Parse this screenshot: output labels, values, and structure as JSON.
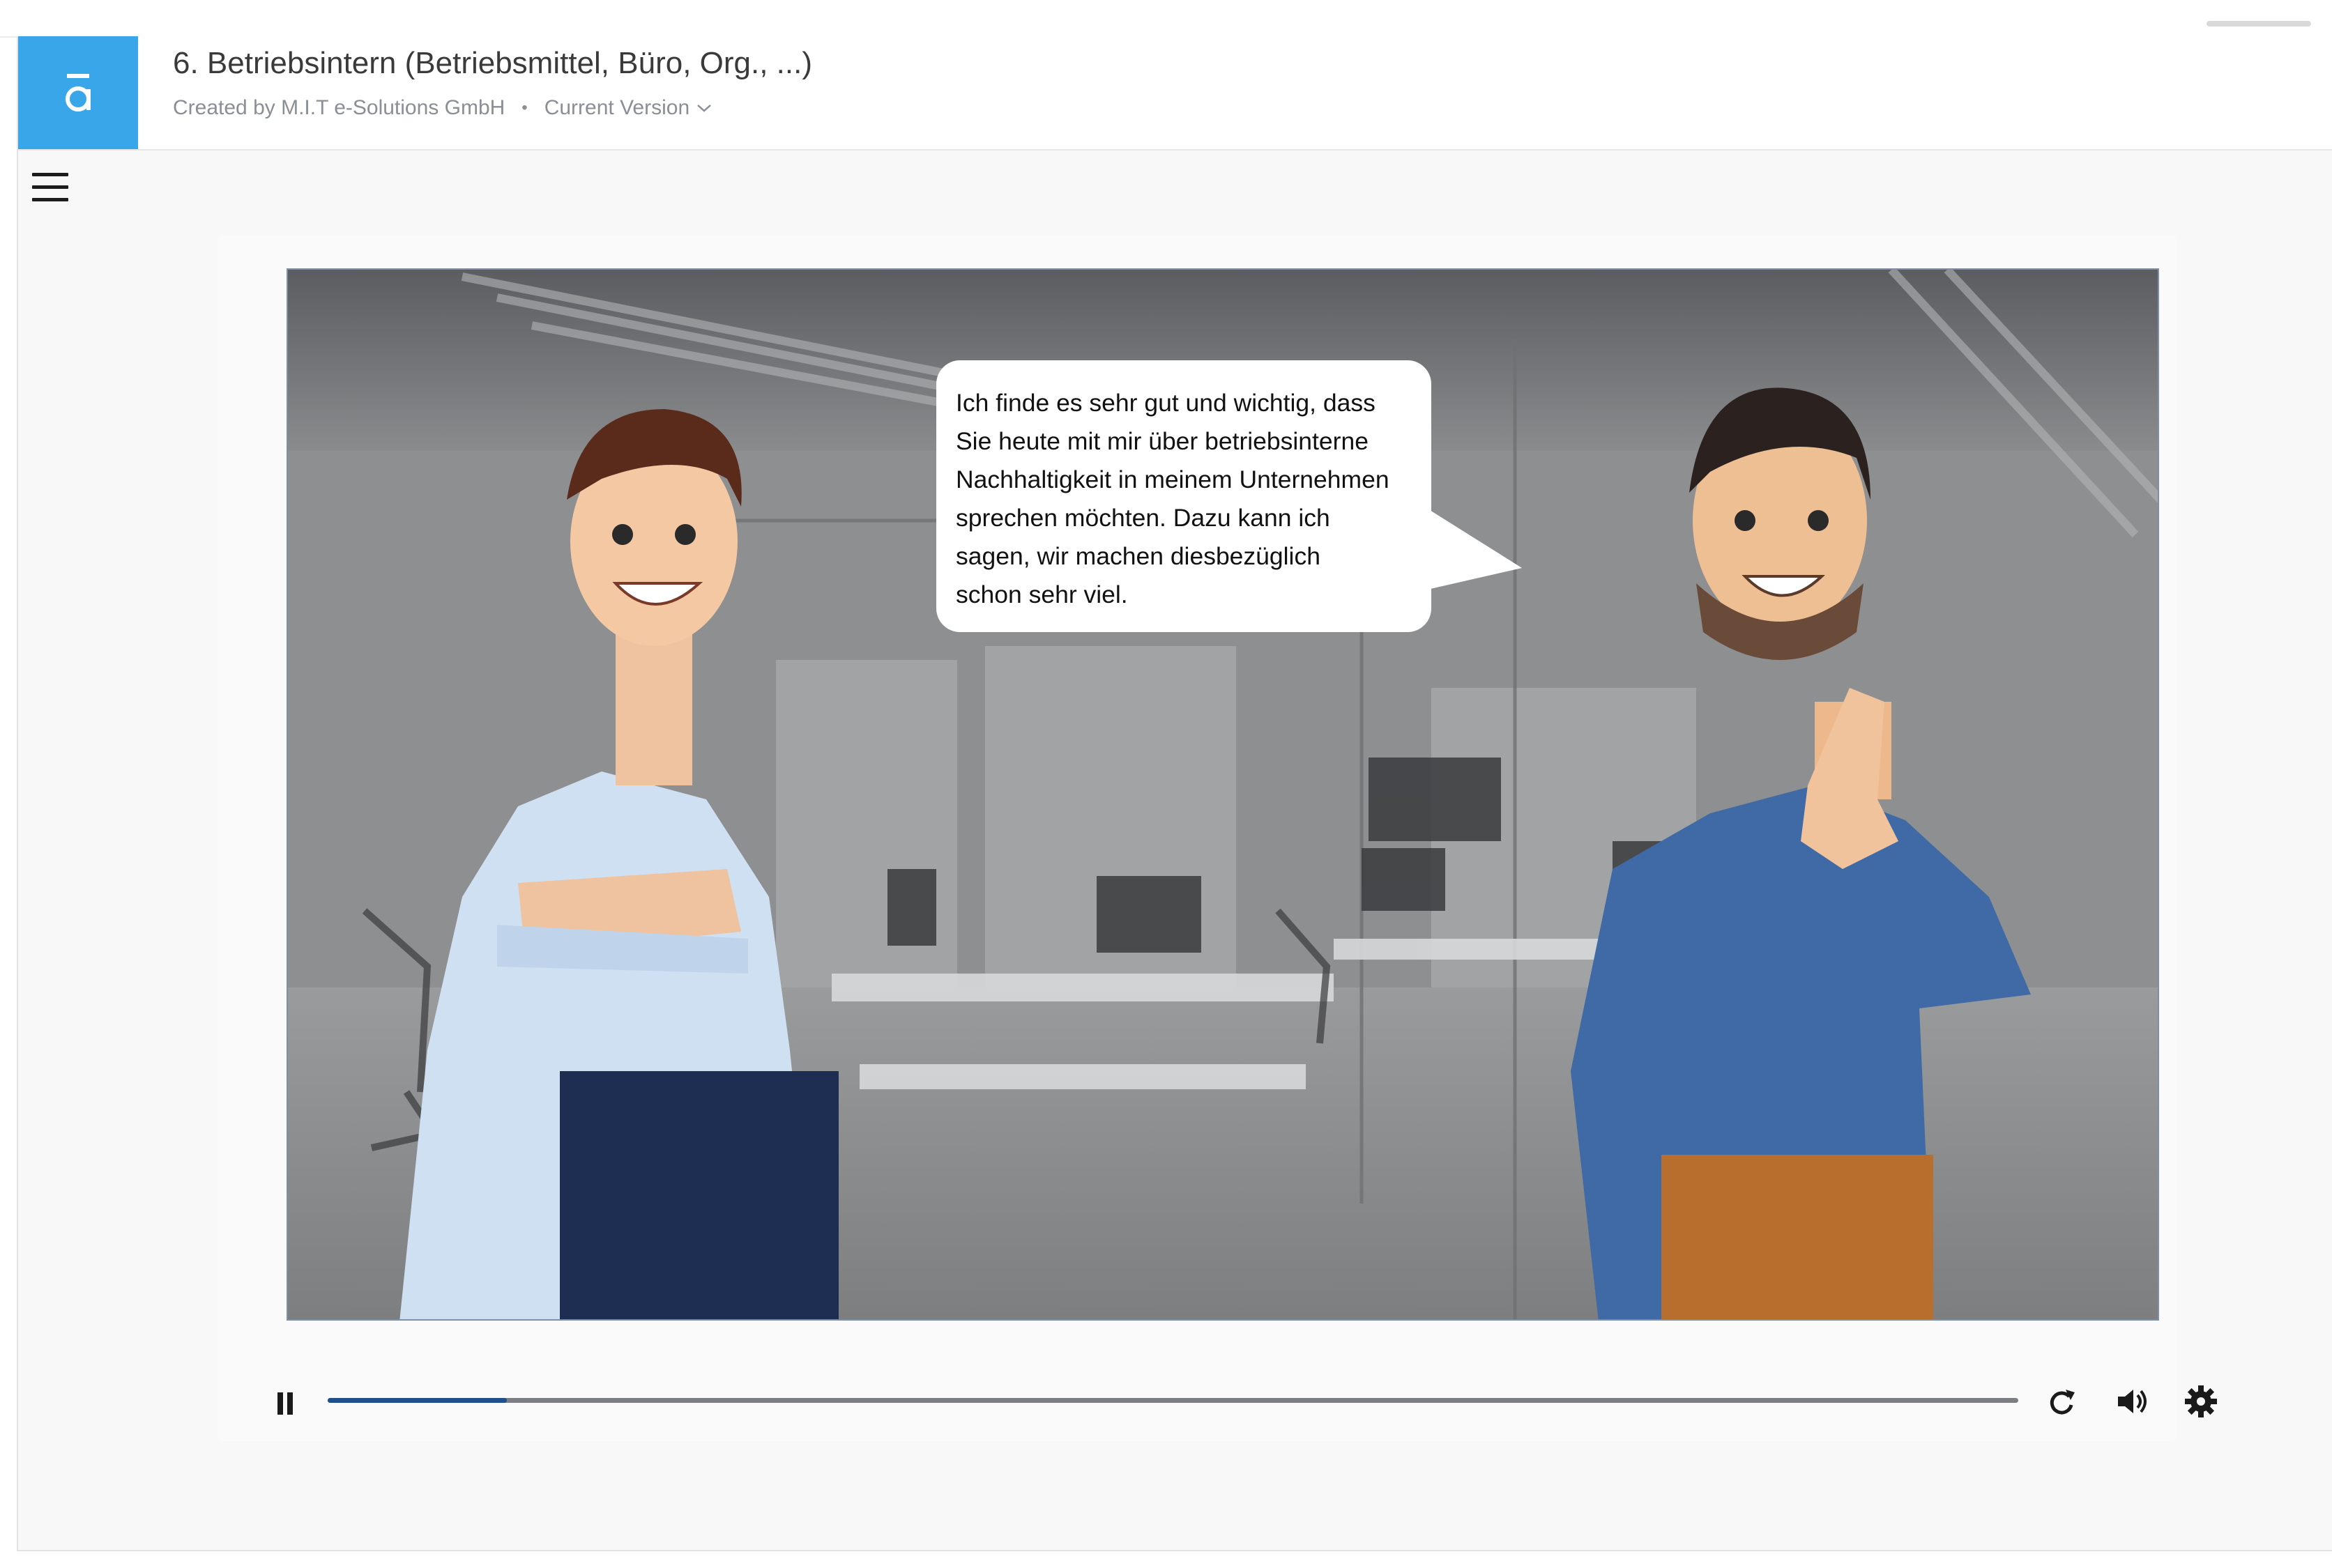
{
  "header": {
    "title": "6. Betriebsintern (Betriebsmittel, Büro, Org., ...)",
    "created_by": "Created by M.I.T e-Solutions GmbH",
    "separator": "•",
    "version_label": "Current Version",
    "logo_glyph": "ā",
    "logo_color": "#39a6ea"
  },
  "video": {
    "speech_bubble": "Ich finde es sehr gut und wichtig, dass\nSie heute mit mir über betriebsinterne\nNachhaltigkeit in meinem Unternehmen\nsprechen möchten. Dazu kann ich\nsagen, wir machen diesbezüglich\nschon sehr viel.",
    "progress": 0.106,
    "progress_color": "#1f4f8b"
  },
  "controls": {
    "pause_icon": "pause-icon",
    "replay_icon": "replay-icon",
    "volume_icon": "volume-icon",
    "settings_icon": "gear-icon"
  }
}
